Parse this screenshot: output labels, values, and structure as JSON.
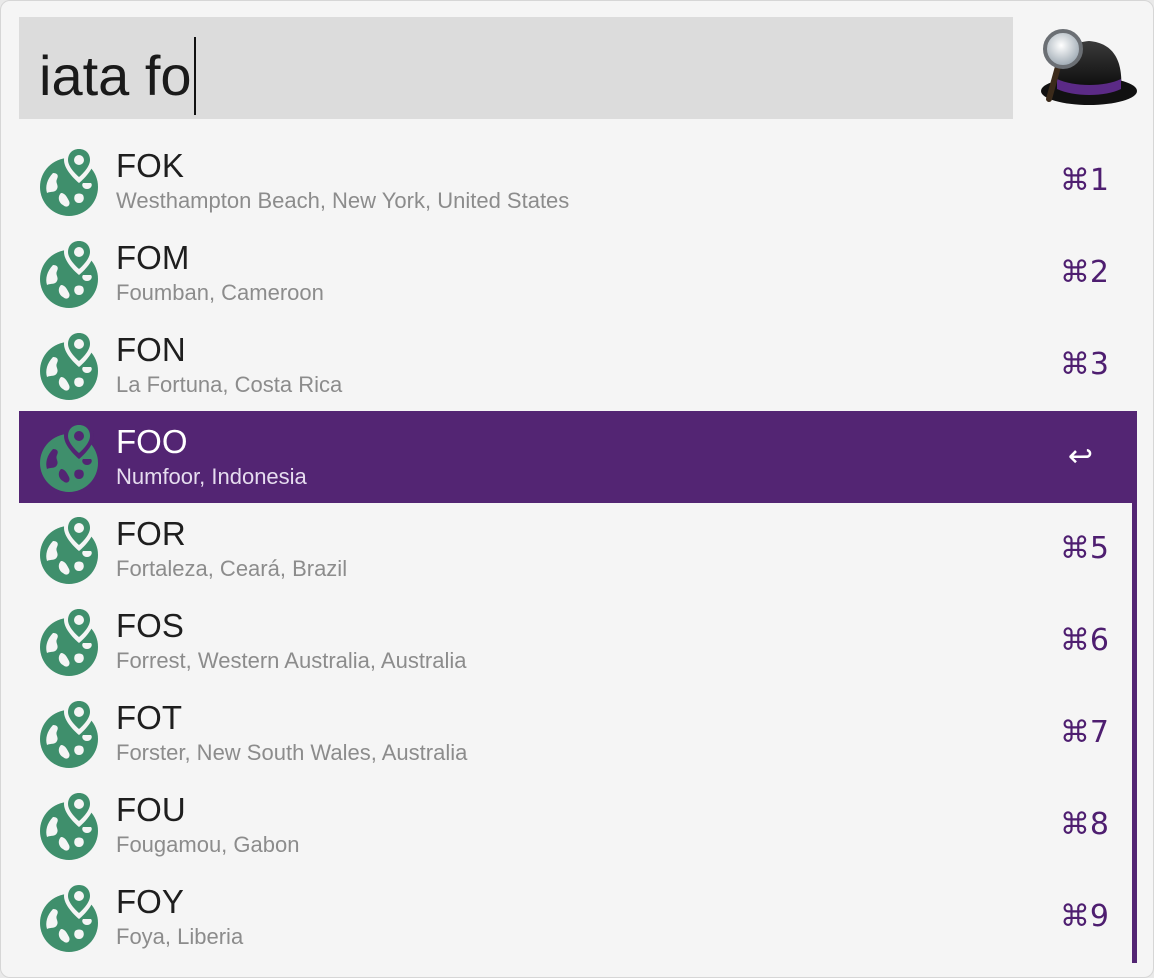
{
  "search": {
    "query": "iata fo"
  },
  "app": {
    "logo_icon": "alfred-hat-icon"
  },
  "colors": {
    "accent": "#532573",
    "globe_icon": "#3f8f6c",
    "shortcut_text": "#4e1e70"
  },
  "results": [
    {
      "title": "FOK",
      "subtitle": "Westhampton Beach, New York, United States",
      "shortcut": "⌘1",
      "selected": false
    },
    {
      "title": "FOM",
      "subtitle": "Foumban, Cameroon",
      "shortcut": "⌘2",
      "selected": false
    },
    {
      "title": "FON",
      "subtitle": "La Fortuna, Costa Rica",
      "shortcut": "⌘3",
      "selected": false
    },
    {
      "title": "FOO",
      "subtitle": "Numfoor, Indonesia",
      "shortcut": "↩",
      "selected": true
    },
    {
      "title": "FOR",
      "subtitle": "Fortaleza, Ceará, Brazil",
      "shortcut": "⌘5",
      "selected": false
    },
    {
      "title": "FOS",
      "subtitle": "Forrest, Western Australia, Australia",
      "shortcut": "⌘6",
      "selected": false
    },
    {
      "title": "FOT",
      "subtitle": "Forster, New South Wales, Australia",
      "shortcut": "⌘7",
      "selected": false
    },
    {
      "title": "FOU",
      "subtitle": "Fougamou, Gabon",
      "shortcut": "⌘8",
      "selected": false
    },
    {
      "title": "FOY",
      "subtitle": "Foya, Liberia",
      "shortcut": "⌘9",
      "selected": false
    }
  ],
  "result_icon": "globe-location-icon"
}
